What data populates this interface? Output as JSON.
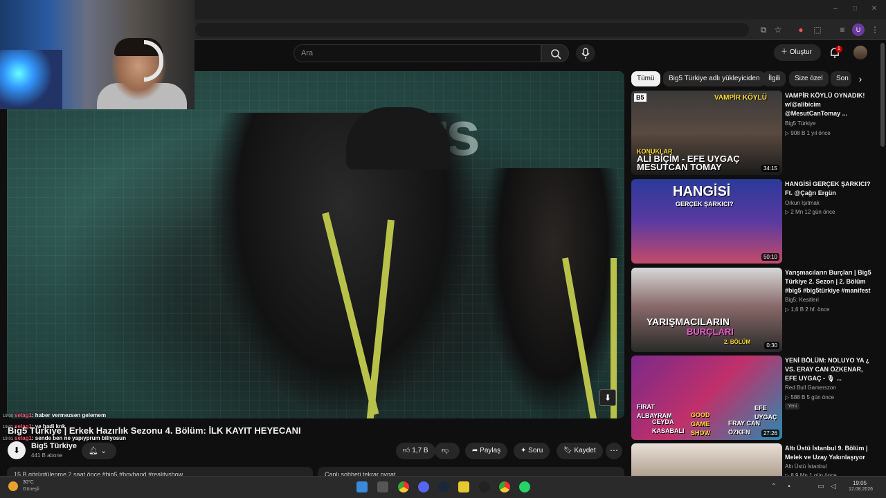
{
  "browser": {
    "window_controls": [
      "–",
      "□",
      "✕"
    ],
    "toolbar_icons": [
      "cast-icon",
      "star-icon",
      "extension-icon",
      "puzzle-icon",
      "playlist-icon",
      "profile-icon",
      "menu-icon"
    ],
    "profile_letter": "U"
  },
  "header": {
    "search_placeholder": "Ara",
    "create_label": "Oluştur",
    "notif_count": "1"
  },
  "webcam": {},
  "chat": [
    {
      "time": "19:00",
      "user": "selag1",
      "msg": ": haber vermezsen gelemem"
    },
    {
      "time": "19:01",
      "user": "selag1",
      "msg": ": ye hadi knk"
    },
    {
      "time": "19:01",
      "user": "selag1",
      "msg": ": sende ben ne yapıyprum biliyosun"
    }
  ],
  "video": {
    "sign_text": "pers",
    "title": "Big5 Türkiye | Erkek Hazırlık Sezonu 4. Bölüm: İLK KAYIT HEYECANI",
    "channel_name": "Big5 Türkiye",
    "subscribers": "441 B abone",
    "likes": "1,7 B",
    "share_label": "Paylaş",
    "ask_label": "Soru",
    "save_label": "Kaydet",
    "description_snippet": "15 B görüntülenme  2 saat önce  #big5 #boyband #realityshow",
    "live_chat_label": "Canlı sohbeti tekrar oynat"
  },
  "chips": [
    "Tümü",
    "Big5 Türkiye adlı yükleyiciden",
    "İlgili",
    "Size özel",
    "Son"
  ],
  "sidebar_videos": [
    {
      "title_line1": "VAMPİR KÖYLÜ OYNADIK!",
      "title_line2": "w/@alibicim",
      "title_line3": "@MesutCanTomay ...",
      "channel": "Big5 Türkiye",
      "meta": "▷ 908 B  1 yıl önce",
      "duration": "34:15",
      "thumb_top": "VAMPİR KÖYLÜ",
      "thumb_sub": "KONUKLAR",
      "thumb_l1": "ALİ BİÇİM - EFE UYGAÇ",
      "thumb_l2": "MESUTCAN TOMAY"
    },
    {
      "title_line1": "HANGİSİ GERÇEK ŞARKICI?",
      "title_line2": "Ft. @Çağrı Ergün",
      "channel": "Orkun Işıtmak",
      "meta": "▷ 2 Mn  12 gün önce",
      "duration": "50:10",
      "thumb_l1": "HANGİSİ",
      "thumb_l2": "GERÇEK ŞARKICI?"
    },
    {
      "title_line1": "Yarışmacıların Burçları | Big5",
      "title_line2": "Türkiye 2. Sezon | 2. Bölüm",
      "title_line3": "#big5 #big5türkiye #manifest",
      "channel": "Big5: Kesitleri",
      "meta": "▷ 1,6 B  2 hf. önce",
      "duration": "0:30",
      "thumb_l1": "YARIŞMACILARIN",
      "thumb_l2": "BURÇLARI",
      "thumb_l3": "2. BÖLÜM"
    },
    {
      "title_line1": "YENİ BÖLÜM: NOLUYO YA ¿",
      "title_line2": "VS. ERAY CAN ÖZKENAR,",
      "title_line3": "EFE UYGAÇ - 🎙 ...",
      "channel": "Red Bull Gamerszon",
      "meta": "▷ 588 B  5 gün önce",
      "badge": "Yeni",
      "duration": "27:26",
      "thumb_l1": "FIRAT ALBAYRAM",
      "thumb_l2": "CEYDA KASABALI",
      "thumb_l3": "GOOD GAME SHOW",
      "thumb_l4": "EFE UYGAÇ",
      "thumb_l5": "ERAY CAN ÖZKEN"
    },
    {
      "title_line1": "Altı Üstü İstanbul 9. Bölüm |",
      "title_line2": "Melek ve Uzay Yakınlaşıyor",
      "channel": "Altı Üstü İstanbul",
      "meta": "▷ 8,9 Mn  1 gün önce"
    }
  ],
  "taskbar": {
    "temp": "30°C",
    "weather": "Güneşli",
    "time": "19:05",
    "date": "12.08.2026"
  },
  "colors": {
    "bg": "#0f0f0f",
    "chip_bg": "#272727",
    "accent_red": "#cc0000",
    "lanyard": "#b8c24a"
  }
}
